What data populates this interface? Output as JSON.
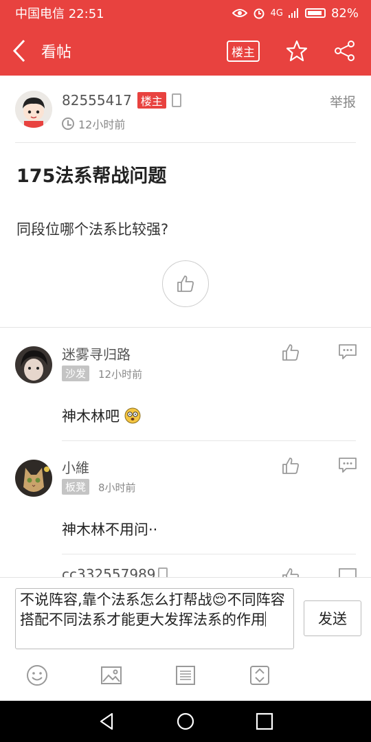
{
  "status_bar": {
    "carrier_time": "中国电信 22:51",
    "network": "4G",
    "battery_pct": "82%"
  },
  "appbar": {
    "title": "看帖",
    "owner_only_label": "楼主"
  },
  "post": {
    "author": "82555417",
    "owner_badge": "楼主",
    "time": "12小时前",
    "report_label": "举报",
    "title": "175法系帮战问题",
    "body": "同段位哪个法系比较强?"
  },
  "replies": [
    {
      "name": "迷雾寻归路",
      "floor": "沙发",
      "time": "12小时前",
      "content": "神木林吧"
    },
    {
      "name": "小維",
      "floor": "板凳",
      "time": "8小时前",
      "content": "神木林不用问··"
    }
  ],
  "partial_reply": {
    "name": "cc332557989"
  },
  "composer": {
    "input_text": "不说阵容,靠个法系怎么打帮战😌不同阵容搭配不同法系才能更大发挥法系的作用",
    "send_label": "发送"
  },
  "colors": {
    "accent": "#e8423f"
  }
}
